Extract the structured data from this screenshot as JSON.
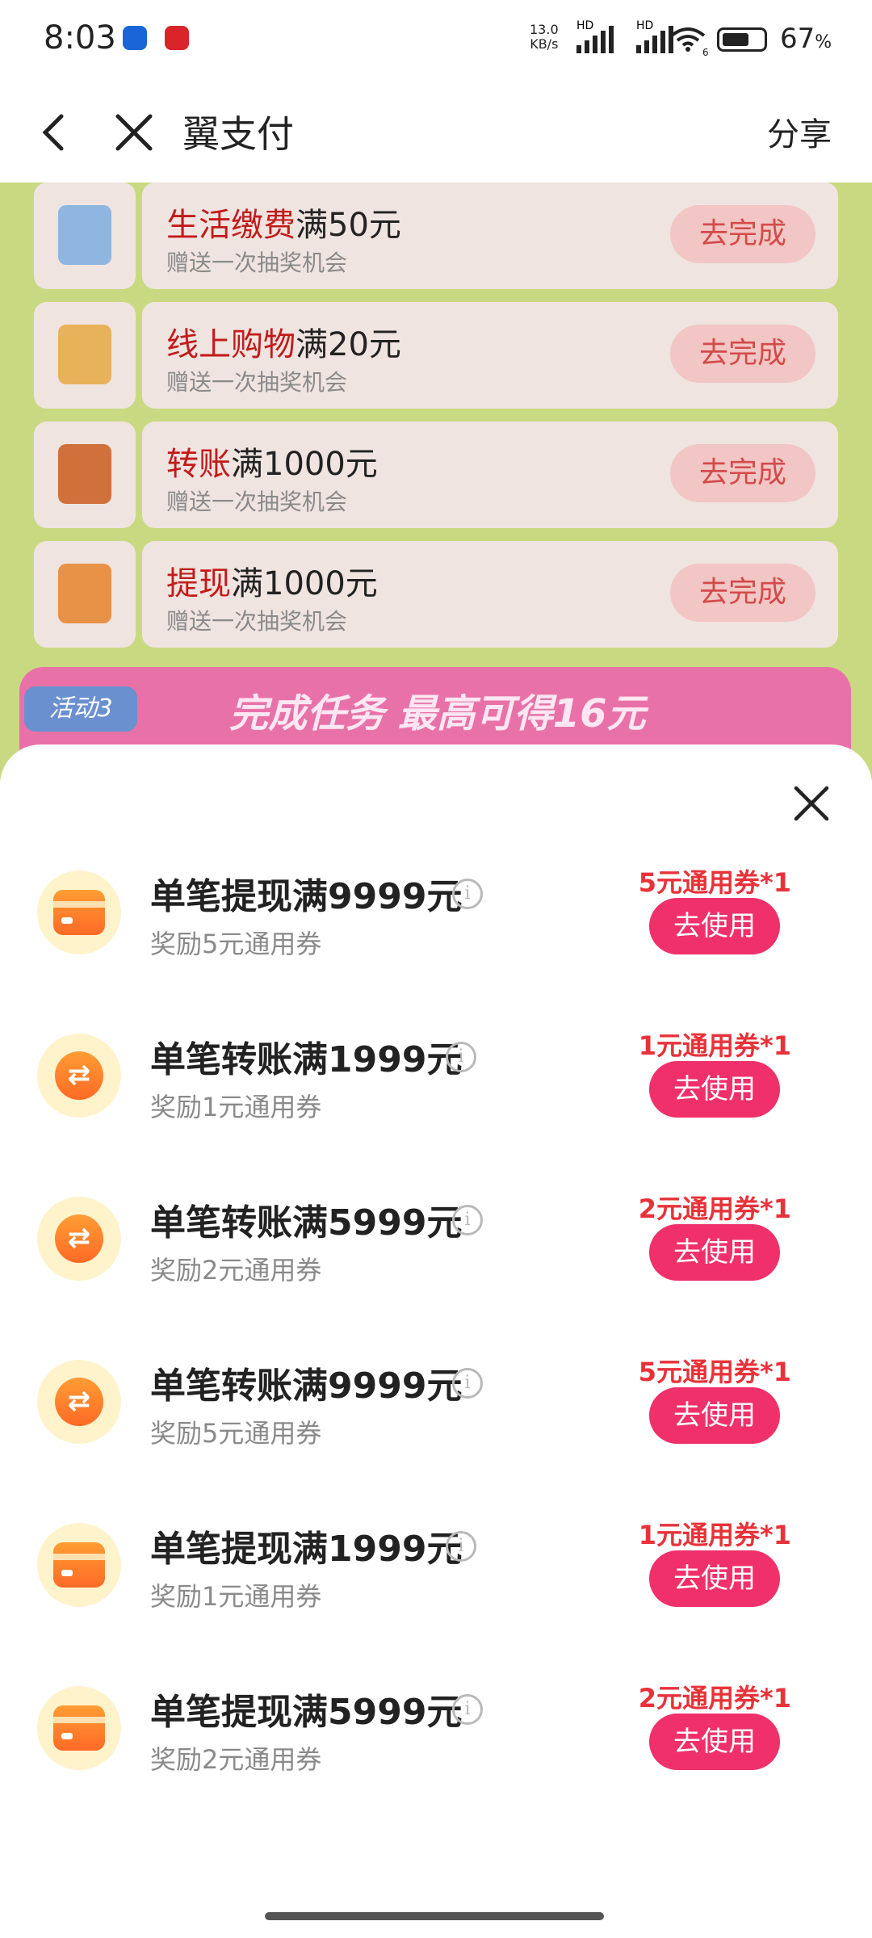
{
  "status_bar": {
    "time": "8:03",
    "net_speed_value": "13.0",
    "net_speed_unit": "KB/s",
    "hd1": "HD",
    "hd2": "HD",
    "battery_pct": "67",
    "battery_unit": "%",
    "wifi_num": "6"
  },
  "nav": {
    "title": "翼支付",
    "share_label": "分享"
  },
  "background_tasks": [
    {
      "title_red": "生活缴费",
      "title_rest": "满50元",
      "sub": "赠送一次抽奖机会",
      "button": "去完成"
    },
    {
      "title_red": "线上购物",
      "title_rest": "满20元",
      "sub": "赠送一次抽奖机会",
      "button": "去完成"
    },
    {
      "title_red": "",
      "title_rest": "转账满1000元",
      "sub": "赠送一次抽奖机会",
      "button": "去完成"
    },
    {
      "title_red": "",
      "title_rest": "提现满1000元",
      "sub": "赠送一次抽奖机会",
      "button": "去完成"
    }
  ],
  "banner": {
    "tag": "活动3",
    "text": "完成任务 最高可得16元"
  },
  "sheet": {
    "items": [
      {
        "title": "单笔提现满9999元",
        "sub": "奖励5元通用券",
        "reward": "5元通用券*1",
        "button": "去使用",
        "icon": "card-icon"
      },
      {
        "title": "单笔转账满1999元",
        "sub": "奖励1元通用券",
        "reward": "1元通用券*1",
        "button": "去使用",
        "icon": "transfer-icon"
      },
      {
        "title": "单笔转账满5999元",
        "sub": "奖励2元通用券",
        "reward": "2元通用券*1",
        "button": "去使用",
        "icon": "transfer-icon"
      },
      {
        "title": "单笔转账满9999元",
        "sub": "奖励5元通用券",
        "reward": "5元通用券*1",
        "button": "去使用",
        "icon": "transfer-icon"
      },
      {
        "title": "单笔提现满1999元",
        "sub": "奖励1元通用券",
        "reward": "1元通用券*1",
        "button": "去使用",
        "icon": "card-icon"
      },
      {
        "title": "单笔提现满5999元",
        "sub": "奖励2元通用券",
        "reward": "2元通用券*1",
        "button": "去使用",
        "icon": "card-icon"
      }
    ],
    "info_glyph": "i",
    "transfer_glyph": "⇄"
  }
}
